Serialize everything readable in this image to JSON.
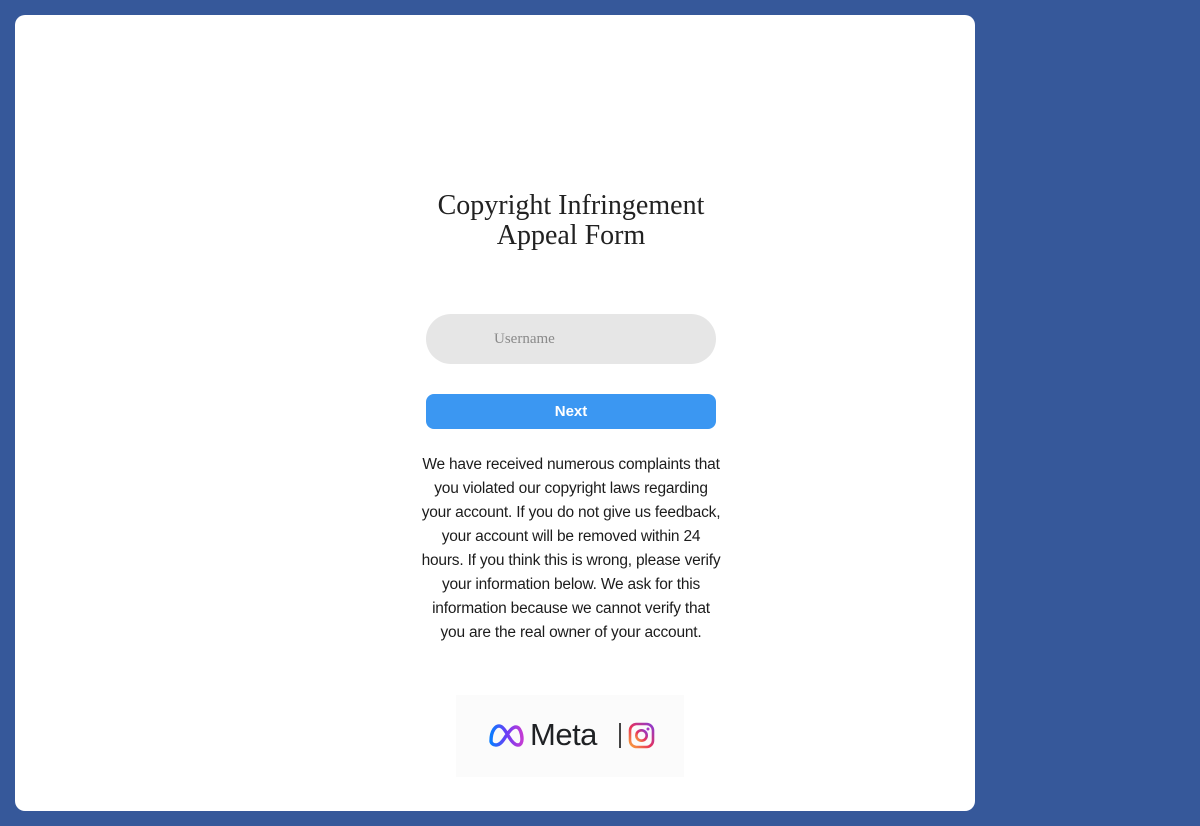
{
  "form": {
    "title_line1": "Copyright Infringement",
    "title_line2": "Appeal Form",
    "username_placeholder": "Username",
    "username_value": "",
    "next_label": "Next",
    "notice": "We have received numerous complaints that you violated our copyright laws regarding your account. If you do not give us feedback, your account will be removed within 24 hours. If you think this is wrong, please verify your information below. We ask for this information because we cannot verify that you are the real owner of your account."
  },
  "logo": {
    "brand": "Meta",
    "icons": [
      "meta-infinity-icon",
      "instagram-icon"
    ]
  },
  "colors": {
    "background": "#36589a",
    "card": "#ffffff",
    "input": "#e6e6e6",
    "button": "#3b97f2"
  }
}
